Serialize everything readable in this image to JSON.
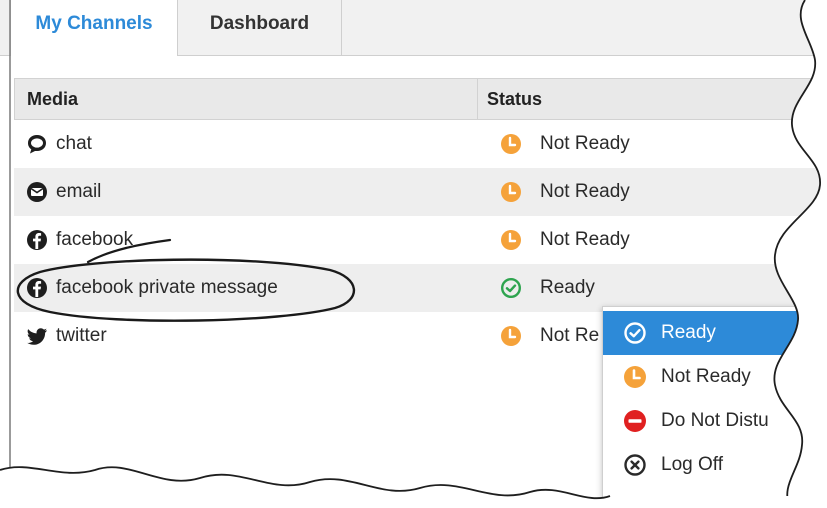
{
  "tabs": [
    {
      "label": "My Channels",
      "active": true
    },
    {
      "label": "Dashboard",
      "active": false
    }
  ],
  "table": {
    "columns": [
      "Media",
      "Status"
    ],
    "rows": [
      {
        "media": "chat",
        "icon": "chat-icon",
        "status": "Not Ready",
        "status_icon": "clock-icon"
      },
      {
        "media": "email",
        "icon": "email-icon",
        "status": "Not Ready",
        "status_icon": "clock-icon"
      },
      {
        "media": "facebook",
        "icon": "facebook-icon",
        "status": "Not Ready",
        "status_icon": "clock-icon"
      },
      {
        "media": "facebook private message",
        "icon": "facebook-icon",
        "status": "Ready",
        "status_icon": "check-circle-icon"
      },
      {
        "media": "twitter",
        "icon": "twitter-icon",
        "status": "Not Re",
        "status_icon": "clock-icon"
      }
    ]
  },
  "status_menu": {
    "items": [
      {
        "label": "Ready",
        "icon": "check-circle-icon",
        "selected": true
      },
      {
        "label": "Not Ready",
        "icon": "clock-icon",
        "selected": false
      },
      {
        "label": "Do Not Distu",
        "icon": "do-not-disturb-icon",
        "selected": false
      },
      {
        "label": "Log Off",
        "icon": "log-off-icon",
        "selected": false
      }
    ]
  },
  "colors": {
    "accent": "#2d8ad8",
    "not_ready": "#f5a23a",
    "ready": "#2ea44f",
    "dnd": "#e02020"
  }
}
